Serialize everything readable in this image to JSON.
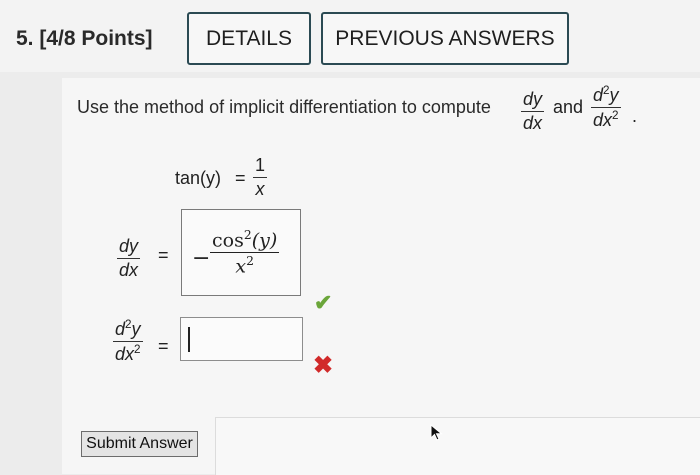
{
  "header": {
    "question_label": "5. [4/8 Points]",
    "details_label": "DETAILS",
    "previous_answers_label": "PREVIOUS ANSWERS"
  },
  "prompt": {
    "text": "Use the method of implicit differentiation to compute",
    "and": "and",
    "period": ".",
    "dy_num": "dy",
    "dy_den": "dx",
    "d2y_num_d": "d",
    "d2y_num_exp": "2",
    "d2y_num_y": "y",
    "d2y_den_dx": "dx",
    "d2y_den_exp": "2"
  },
  "equation": {
    "left": "tan(y)",
    "equals": "=",
    "rhs_num": "1",
    "rhs_den": "x"
  },
  "first_derivative": {
    "label_num": "dy",
    "label_den": "dx",
    "equals": "=",
    "answer_sign": "−",
    "answer_num_func": "cos",
    "answer_num_exp": "2",
    "answer_num_arg": "(y)",
    "answer_den_var": "x",
    "answer_den_exp": "2",
    "status": "correct",
    "status_color": "#6ba63a"
  },
  "second_derivative": {
    "label_num_d": "d",
    "label_num_exp": "2",
    "label_num_y": "y",
    "label_den_dx": "dx",
    "label_den_exp": "2",
    "equals": "=",
    "answer_value": "",
    "status": "incorrect",
    "status_color": "#d12a2a"
  },
  "submit": {
    "label": "Submit Answer"
  }
}
